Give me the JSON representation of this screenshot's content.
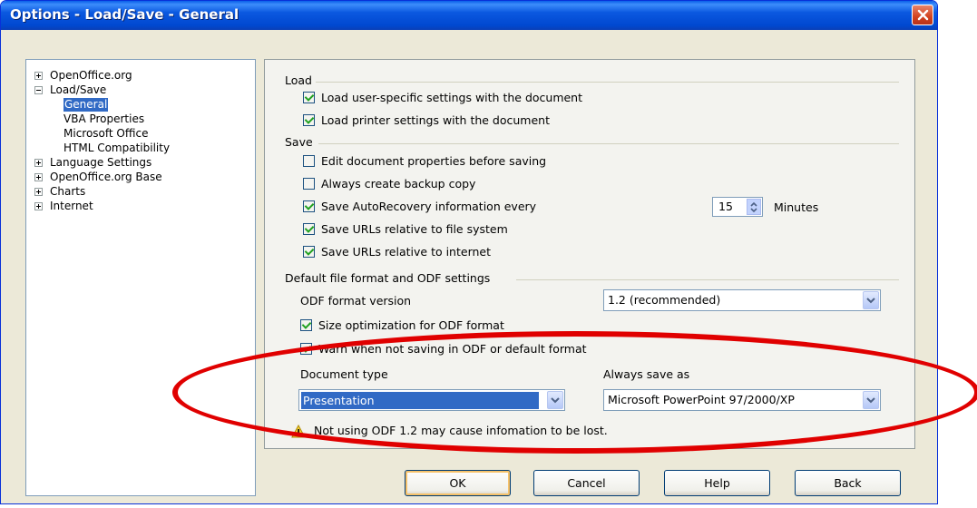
{
  "window": {
    "title": "Options - Load/Save - General"
  },
  "tree": [
    {
      "label": "OpenOffice.org",
      "expander": "plus",
      "level": 0
    },
    {
      "label": "Load/Save",
      "expander": "minus",
      "level": 0
    },
    {
      "label": "General",
      "level": 1,
      "selected": true
    },
    {
      "label": "VBA Properties",
      "level": 1
    },
    {
      "label": "Microsoft Office",
      "level": 1
    },
    {
      "label": "HTML Compatibility",
      "level": 1
    },
    {
      "label": "Language Settings",
      "expander": "plus",
      "level": 0
    },
    {
      "label": "OpenOffice.org Base",
      "expander": "plus",
      "level": 0
    },
    {
      "label": "Charts",
      "expander": "plus",
      "level": 0
    },
    {
      "label": "Internet",
      "expander": "plus",
      "level": 0
    }
  ],
  "load": {
    "title": "Load",
    "options": [
      {
        "label": "Load user-specific settings with the document",
        "checked": true
      },
      {
        "label": "Load printer settings with the document",
        "checked": true
      }
    ]
  },
  "save": {
    "title": "Save",
    "options": [
      {
        "label": "Edit document properties before saving",
        "checked": false
      },
      {
        "label": "Always create backup copy",
        "checked": false
      },
      {
        "label": "Save AutoRecovery information every",
        "checked": true
      },
      {
        "label": "Save URLs relative to file system",
        "checked": true
      },
      {
        "label": "Save URLs relative to internet",
        "checked": true
      }
    ],
    "autorecovery_value": "15",
    "autorecovery_unit": "Minutes"
  },
  "format": {
    "title": "Default file format and ODF settings",
    "odf_version_label": "ODF format version",
    "odf_version_value": "1.2 (recommended)",
    "size_opt_label": "Size optimization for ODF format",
    "size_opt_checked": true,
    "warn_label": "Warn when not saving in ODF or default format",
    "warn_checked": true,
    "doc_type_label": "Document type",
    "doc_type_value": "Presentation",
    "always_save_label": "Always save as",
    "always_save_value": "Microsoft PowerPoint 97/2000/XP",
    "warning_text": "Not using ODF 1.2 may cause infomation to be lost."
  },
  "buttons": {
    "ok": "OK",
    "cancel": "Cancel",
    "help": "Help",
    "back": "Back"
  },
  "colors": {
    "annotation": "#e00000",
    "title_bar": "#0054e3",
    "selection": "#316ac5"
  }
}
